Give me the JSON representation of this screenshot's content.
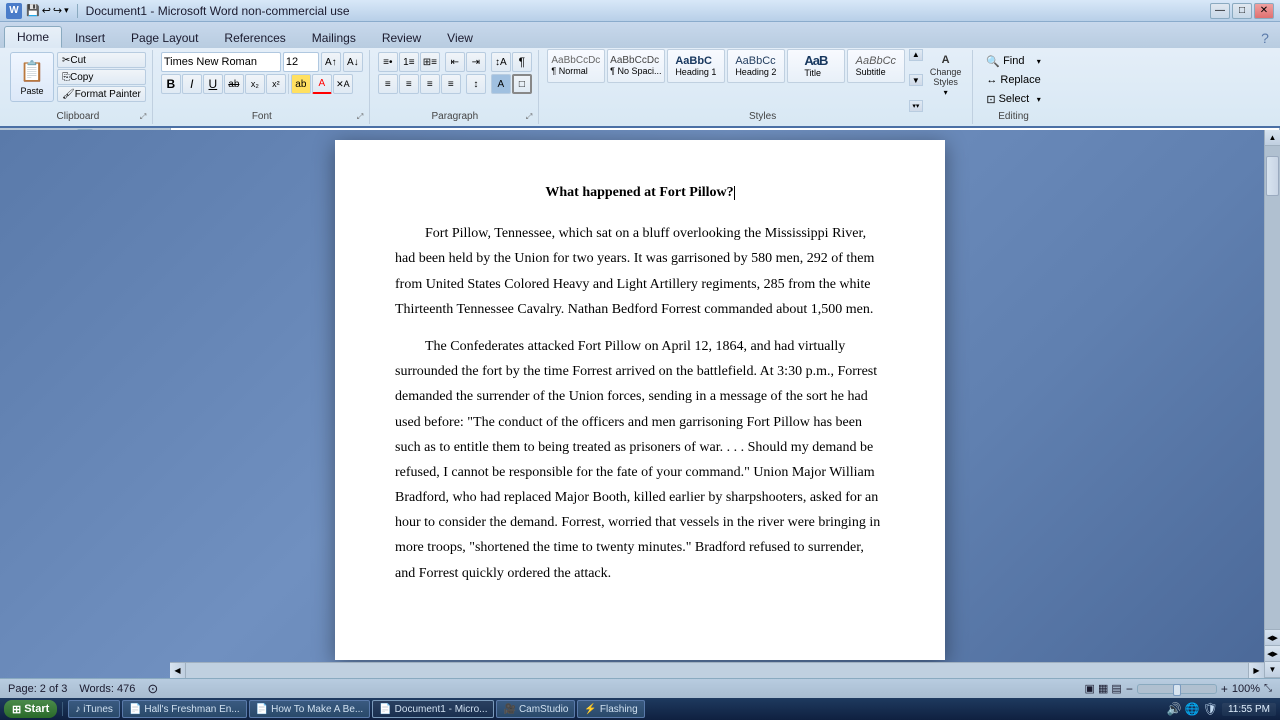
{
  "window": {
    "title": "Document1 - Microsoft Word non-commercial use",
    "min_label": "—",
    "max_label": "□",
    "close_label": "✕"
  },
  "quick_access": {
    "save_icon": "💾",
    "undo_icon": "↩",
    "redo_icon": "↪",
    "dropdown_icon": "▾"
  },
  "ribbon": {
    "tabs": [
      "Home",
      "Insert",
      "Page Layout",
      "References",
      "Mailings",
      "Review",
      "View"
    ],
    "active_tab": "Home",
    "groups": {
      "clipboard": {
        "label": "Clipboard",
        "paste_label": "Paste",
        "cut_label": "Cut",
        "copy_label": "Copy",
        "format_painter_label": "Format Painter"
      },
      "font": {
        "label": "Font",
        "font_name": "Times New Roman",
        "font_size": "12",
        "bold": "B",
        "italic": "I",
        "underline": "U",
        "strikethrough": "ab",
        "subscript": "x₂",
        "superscript": "x²",
        "highlight": "A",
        "color": "A"
      },
      "paragraph": {
        "label": "Paragraph"
      },
      "styles": {
        "label": "Styles",
        "items": [
          {
            "name": "Normal",
            "label": "¶ Normal"
          },
          {
            "name": "No Spacing",
            "label": "¶ No Spaci..."
          },
          {
            "name": "Heading 1",
            "label": "Heading 1"
          },
          {
            "name": "Heading 2",
            "label": "Heading 2"
          },
          {
            "name": "Title",
            "label": "Title"
          },
          {
            "name": "Subtitle",
            "label": "Subtitle"
          }
        ],
        "change_label": "Change\nStyles"
      },
      "editing": {
        "label": "Editing",
        "find_label": "Find",
        "replace_label": "Replace",
        "select_label": "Select"
      }
    }
  },
  "document": {
    "title": "What happened at Fort Pillow?",
    "paragraphs": [
      "Fort Pillow, Tennessee, which sat on a bluff overlooking the Mississippi River, had been held by the Union for two years. It was garrisoned by 580 men, 292 of them from United States Colored Heavy and Light Artillery regiments, 285 from the white Thirteenth Tennessee Cavalry. Nathan Bedford Forrest commanded about 1,500 men.",
      "The Confederates attacked Fort Pillow on April 12, 1864, and had virtually surrounded the fort by the time Forrest arrived on the battlefield. At 3:30 p.m., Forrest demanded the surrender of the Union forces, sending in a message of the sort he had used before: \"The conduct of the officers and men garrisoning Fort Pillow has been such as to entitle them to being treated as prisoners of war. . . . Should my demand be refused, I cannot be responsible for the fate of your command.\" Union Major William Bradford, who had replaced Major Booth, killed earlier by sharpshooters, asked for an hour to consider the demand. Forrest, worried that vessels in the river were bringing in more troops, \"shortened the time to twenty minutes.\" Bradford refused to surrender, and Forrest quickly ordered the attack."
    ]
  },
  "status_bar": {
    "page_info": "Page: 2 of 3",
    "words_info": "Words: 476",
    "view_icons": "▣ ▦ ▤",
    "zoom_level": "100%",
    "zoom_minus": "−",
    "zoom_plus": "+"
  },
  "taskbar": {
    "start_label": "⊞ Start",
    "items": [
      {
        "label": "iTunes",
        "icon": "♪"
      },
      {
        "label": "Hall's Freshman En...",
        "icon": "📄"
      },
      {
        "label": "How To Make A Be...",
        "icon": "📄"
      },
      {
        "label": "Document1 - Micro...",
        "icon": "📄",
        "active": true
      },
      {
        "label": "CamStudio",
        "icon": "🎥"
      },
      {
        "label": "Flashing",
        "icon": "⚡"
      }
    ],
    "time": "11:55 PM"
  }
}
